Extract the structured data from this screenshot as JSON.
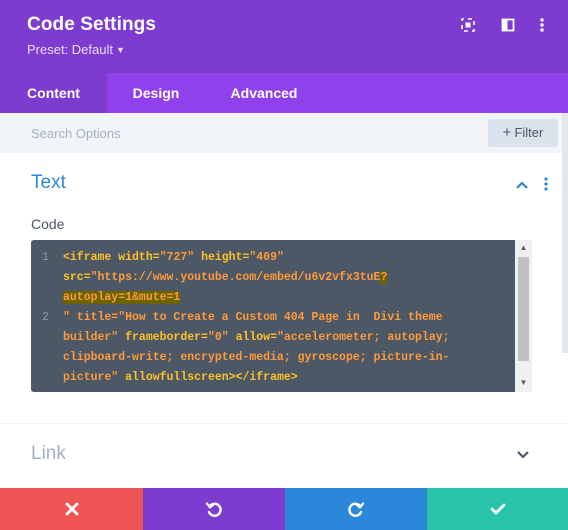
{
  "header": {
    "title": "Code Settings",
    "preset": "Preset: Default",
    "icons": [
      "expand-icon",
      "split-view-icon",
      "more-options-icon"
    ]
  },
  "tabs": [
    {
      "label": "Content",
      "active": true
    },
    {
      "label": "Design",
      "active": false
    },
    {
      "label": "Advanced",
      "active": false
    }
  ],
  "search": {
    "placeholder": "Search Options",
    "value": "",
    "filter_label": "Filter"
  },
  "sections": {
    "text": {
      "title": "Text",
      "expanded": true
    },
    "link": {
      "title": "Link",
      "expanded": false
    }
  },
  "code_field": {
    "label": "Code",
    "line_numbers": [
      "1",
      "2"
    ],
    "lines": {
      "l1a_tag": "<iframe",
      "l1a_attr1": "width=",
      "l1a_val1": "\"727\"",
      "l1a_attr2": "height=",
      "l1a_val2": "\"409\"",
      "l1b_attr": "src=",
      "l1b_val": "\"https://www.youtube.com/embed/u6v2vfx3tuE",
      "l1b_hl": "?",
      "l1c_hl": "autoplay=1&mute=1",
      "l2a_val": "\" title=\"How to Create a Custom 404 Page in  Divi theme",
      "l2b_val": "builder\"",
      "l2b_attr1": "frameborder=",
      "l2b_val1": "\"0\"",
      "l2b_attr2": "allow=",
      "l2b_val2": "\"accelerometer; autoplay;",
      "l2c_val": "clipboard-write; encrypted-media; gyroscope; picture-in-",
      "l2d_val": "picture\"",
      "l2d_attr": "allowfullscreen",
      "l2d_tag": "></iframe>"
    }
  },
  "footer": {
    "buttons": [
      {
        "name": "discard",
        "color": "#ef5555"
      },
      {
        "name": "undo",
        "color": "#7e3bd0"
      },
      {
        "name": "redo",
        "color": "#2b87da"
      },
      {
        "name": "save",
        "color": "#29c4a9"
      }
    ]
  },
  "colors": {
    "header_bg": "#7e3bd0",
    "tabs_bg": "#8f42ec",
    "section_title": "#2b87da",
    "code_bg": "#4c5866"
  }
}
